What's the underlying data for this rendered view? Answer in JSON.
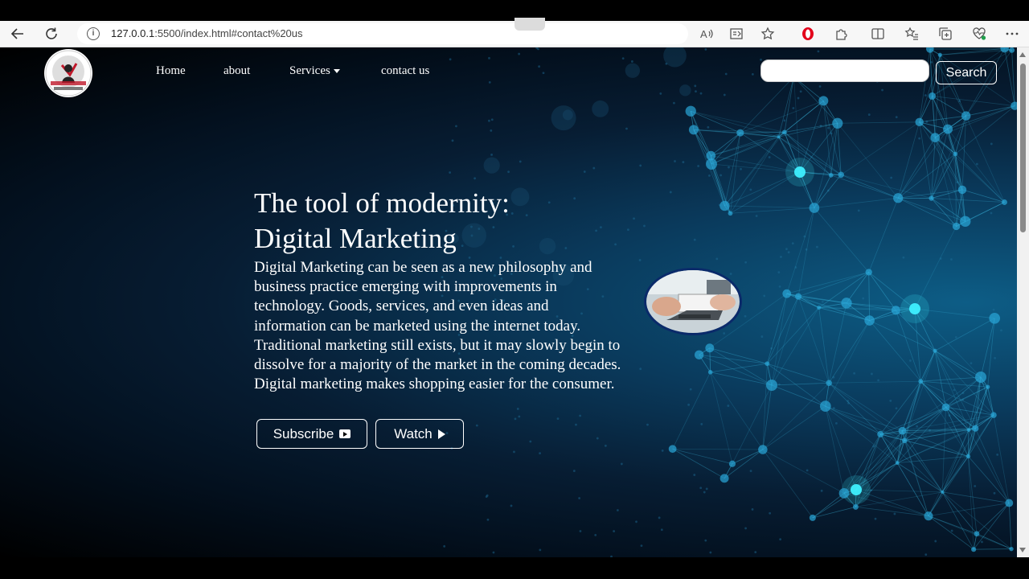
{
  "browser": {
    "url_host": "127.0.0.1",
    "url_path": ":5500/index.html#contact%20us"
  },
  "site": {
    "nav": [
      {
        "label": "Home"
      },
      {
        "label": "about"
      },
      {
        "label": "Services"
      },
      {
        "label": "contact us"
      }
    ],
    "search": {
      "value": "",
      "button_label": "Search"
    },
    "hero": {
      "title_line1": "The tool of modernity:",
      "title_line2": "Digital Marketing",
      "paragraph": "Digital Marketing can be seen as a new philosophy and business practice emerging with improvements in technology. Goods, services, and even ideas and information can be marketed using the internet today. Traditional marketing still exists, but it may slowly begin to dissolve for a majority of the market in the coming decades. Digital marketing makes shopping easier for the consumer.",
      "subscribe_label": "Subscribe",
      "watch_label": "Watch"
    }
  },
  "colors": {
    "accent_glow": "#3ff0ff",
    "bg_deep": "#03101e",
    "bg_mid": "#0a3a5c",
    "opera_red": "#e3001b"
  }
}
